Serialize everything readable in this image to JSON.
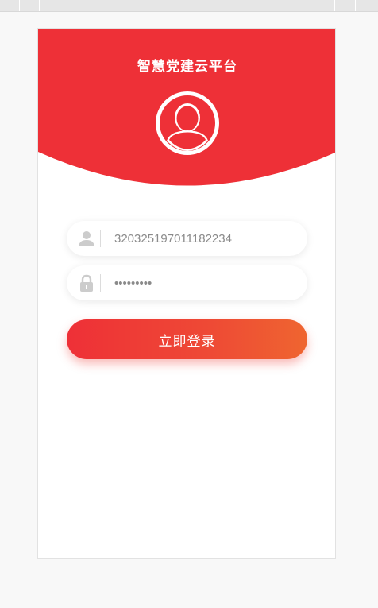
{
  "app": {
    "title": "智慧党建云平台"
  },
  "login": {
    "username_value": "320325197011182234",
    "password_value": "123456789",
    "submit_label": "立即登录"
  },
  "icons": {
    "avatar": "user-avatar-icon",
    "username": "user-icon",
    "password": "lock-icon"
  },
  "colors": {
    "brand_red": "#ee3037",
    "button_gradient_end": "#ef6530",
    "icon_gray": "#cccccc"
  }
}
